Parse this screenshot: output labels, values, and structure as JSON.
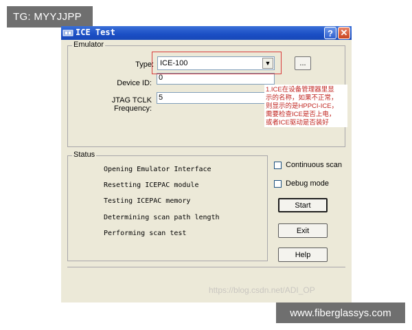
{
  "overlays": {
    "top_left_tag": "TG: MYYJJPP",
    "bottom_right_site": "www.fiberglassys.com",
    "watermark": "https://blog.csdn.net/ADI_OP"
  },
  "window": {
    "title": "ICE Test",
    "help_button": "?",
    "close_button": "✕"
  },
  "emulator": {
    "group_label": "Emulator",
    "type_label": "Type:",
    "type_value": "ICE-100",
    "browse_label": "...",
    "device_id_label": "Device ID:",
    "device_id_value": "0",
    "jtag_label": "JTAG TCLK Frequency:",
    "jtag_value": "5"
  },
  "annotation": {
    "line1": "1.ICE在设备管理器里显",
    "line2": "示的名称，如果不正常，",
    "line3": "则显示的是HPPCI-ICE，",
    "line4": "需要检查ICE是否上电，",
    "line5": "或者ICE驱动是否装好"
  },
  "status": {
    "group_label": "Status",
    "lines": [
      "Opening Emulator Interface",
      "Resetting ICEPAC module",
      "Testing ICEPAC memory",
      "Determining scan path length",
      "Performing scan test"
    ]
  },
  "options": {
    "continuous_scan_label": "Continuous scan",
    "debug_mode_label": "Debug mode"
  },
  "buttons": {
    "start": "Start",
    "exit": "Exit",
    "help": "Help"
  },
  "colors": {
    "titlebar": "#1a4ec4",
    "annotation_text": "#c0241f",
    "annotation_box": "#d83b3b",
    "window_bg": "#ece9d8"
  }
}
